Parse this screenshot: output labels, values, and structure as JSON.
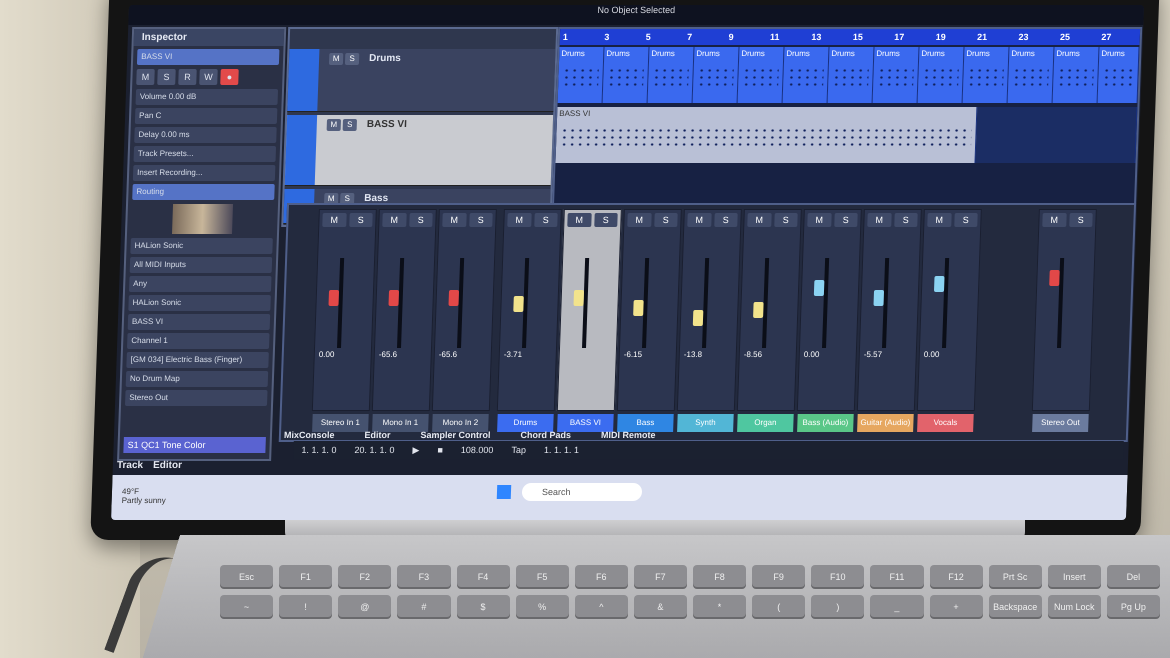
{
  "daw": {
    "window_title": "No Object Selected",
    "inspector": {
      "tab": "Inspector",
      "track_name": "BASS VI",
      "volume_label": "Volume",
      "volume_value": "0.00 dB",
      "pan_label": "Pan",
      "pan_value": "C",
      "delay_label": "Delay",
      "delay_value": "0.00 ms",
      "track_presets": "Track Presets...",
      "insert_recording": "Insert Recording...",
      "routing": "Routing",
      "instrument": "HALion Sonic",
      "midi_input": "All MIDI Inputs",
      "any": "Any",
      "inst_sel": "HALion Sonic",
      "bass_sel": "BASS VI",
      "channel": "Channel 1",
      "preset": "[GM 034] Electric Bass (Finger)",
      "drum_map": "No Drum Map",
      "output": "Stereo Out",
      "tone_color": "S1 QC1 Tone Color"
    },
    "bottom_tabs": [
      "Track",
      "Editor"
    ],
    "lower_zone_tabs": [
      "MixConsole",
      "Editor",
      "Sampler Control",
      "Chord Pads",
      "MIDI Remote"
    ],
    "tracks": [
      {
        "name": "Drums",
        "buttons": [
          "M",
          "S"
        ]
      },
      {
        "name": "BASS VI",
        "buttons": [
          "M",
          "S"
        ]
      },
      {
        "name": "Bass",
        "buttons": [
          "M",
          "S"
        ]
      }
    ],
    "ruler": [
      "1",
      "3",
      "5",
      "7",
      "9",
      "11",
      "13",
      "15",
      "17",
      "19",
      "21",
      "23",
      "25",
      "27"
    ],
    "parts": {
      "drums": "Drums",
      "bass": "BASS VI"
    },
    "mixer": {
      "channels": [
        {
          "label": "Stereo In 1",
          "value": "0.00",
          "color": "#2c3550"
        },
        {
          "label": "Mono In 1",
          "value": "-65.6",
          "color": "#2c3550"
        },
        {
          "label": "Mono In 2",
          "value": "-65.6",
          "color": "#2c3550"
        },
        {
          "label": "Drums",
          "value": "-3.71",
          "color": "#3b6cf0"
        },
        {
          "label": "BASS VI",
          "value": "",
          "color": "#3b6cf0"
        },
        {
          "label": "Bass",
          "value": "-6.15",
          "color": "#2f86e3"
        },
        {
          "label": "Synth",
          "value": "-13.8",
          "color": "#52b6d6"
        },
        {
          "label": "Organ",
          "value": "-8.56",
          "color": "#4fc7a0"
        },
        {
          "label": "Bass (Audio)",
          "value": "0.00",
          "color": "#5ac788"
        },
        {
          "label": "Guitar (Audio)",
          "value": "-5.57",
          "color": "#e6a760"
        },
        {
          "label": "Vocals",
          "value": "0.00",
          "color": "#e2636b"
        }
      ],
      "master_label": "Stereo Out"
    },
    "transport": {
      "left_pos": "1. 1. 1. 0",
      "right_pos": "20. 1. 1. 0",
      "tempo": "108.000",
      "tap": "Tap",
      "time": "1. 1. 1. 1"
    }
  },
  "taskbar": {
    "search_placeholder": "Search",
    "weather_temp": "49°F",
    "weather_text": "Partly sunny"
  },
  "keyboard": {
    "keys": [
      "Esc",
      "F1",
      "F2",
      "F3",
      "F4",
      "F5",
      "F6",
      "F7",
      "F8",
      "F9",
      "F10",
      "F11",
      "F12",
      "Prt Sc",
      "Insert",
      "Del",
      "~",
      "!",
      "@",
      "#",
      "$",
      "%",
      "^",
      "&",
      "*",
      "(",
      ")",
      "_",
      "+",
      "Backspace",
      "Num Lock",
      "Pg Up"
    ]
  }
}
